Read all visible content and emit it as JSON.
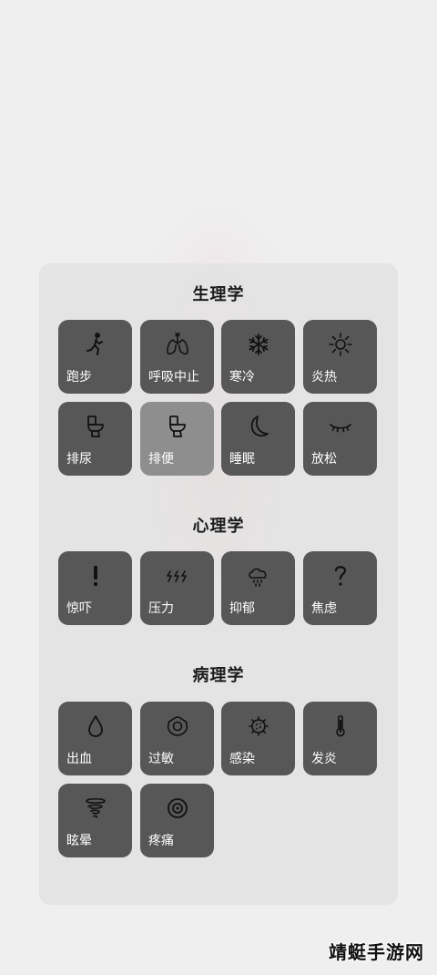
{
  "sections": {
    "physiology": {
      "title": "生理学",
      "items": [
        {
          "label": "跑步",
          "icon": "running-icon"
        },
        {
          "label": "呼吸中止",
          "icon": "lungs-icon"
        },
        {
          "label": "寒冷",
          "icon": "snowflake-icon"
        },
        {
          "label": "炎热",
          "icon": "sun-icon"
        },
        {
          "label": "排尿",
          "icon": "toilet-icon"
        },
        {
          "label": "排便",
          "icon": "toilet-icon"
        },
        {
          "label": "睡眠",
          "icon": "moon-icon"
        },
        {
          "label": "放松",
          "icon": "closed-eye-icon"
        }
      ]
    },
    "psychology": {
      "title": "心理学",
      "items": [
        {
          "label": "惊吓",
          "icon": "exclamation-icon"
        },
        {
          "label": "压力",
          "icon": "lightning-icon"
        },
        {
          "label": "抑郁",
          "icon": "rain-cloud-icon"
        },
        {
          "label": "焦虑",
          "icon": "question-icon"
        }
      ]
    },
    "pathology": {
      "title": "病理学",
      "items": [
        {
          "label": "出血",
          "icon": "drop-icon"
        },
        {
          "label": "过敏",
          "icon": "flower-icon"
        },
        {
          "label": "感染",
          "icon": "virus-icon"
        },
        {
          "label": "发炎",
          "icon": "thermometer-icon"
        },
        {
          "label": "眩晕",
          "icon": "tornado-icon"
        },
        {
          "label": "疼痛",
          "icon": "target-icon"
        }
      ]
    }
  },
  "active_item": "排便",
  "watermark": "靖蜓手游网",
  "colors": {
    "tile": "#575757",
    "tile_active": "#8e8e8e",
    "panel": "#e2e2e2",
    "background": "#efefef"
  }
}
